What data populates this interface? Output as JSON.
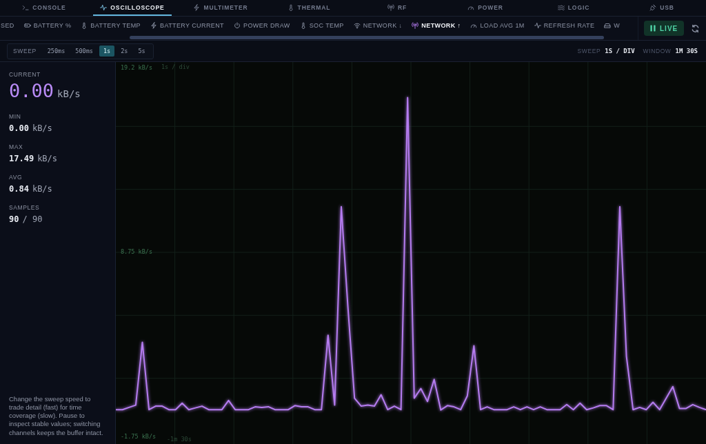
{
  "tabs": [
    {
      "label": "CONSOLE",
      "selected": false
    },
    {
      "label": "OSCILLOSCOPE",
      "selected": true
    },
    {
      "label": "MULTIMETER",
      "selected": false
    },
    {
      "label": "THERMAL",
      "selected": false
    },
    {
      "label": "RF",
      "selected": false
    },
    {
      "label": "POWER",
      "selected": false
    },
    {
      "label": "LOGIC",
      "selected": false
    },
    {
      "label": "USB",
      "selected": false
    }
  ],
  "channels": [
    {
      "label": "SED",
      "selected": false
    },
    {
      "label": "BATTERY %",
      "selected": false
    },
    {
      "label": "BATTERY TEMP",
      "selected": false
    },
    {
      "label": "BATTERY CURRENT",
      "selected": false
    },
    {
      "label": "POWER DRAW",
      "selected": false
    },
    {
      "label": "SOC TEMP",
      "selected": false
    },
    {
      "label": "NETWORK ↓",
      "selected": false
    },
    {
      "label": "NETWORK ↑",
      "selected": true
    },
    {
      "label": "LOAD AVG 1M",
      "selected": false
    },
    {
      "label": "REFRESH RATE",
      "selected": false
    },
    {
      "label": "W",
      "selected": false
    }
  ],
  "live_button": {
    "label": "LIVE",
    "active": true
  },
  "sweep": {
    "label": "SWEEP",
    "options": [
      {
        "label": "250ms",
        "selected": false
      },
      {
        "label": "500ms",
        "selected": false
      },
      {
        "label": "1s",
        "selected": true
      },
      {
        "label": "2s",
        "selected": false
      },
      {
        "label": "5s",
        "selected": false
      }
    ]
  },
  "readouts": [
    {
      "label": "SWEEP",
      "value": "1S / DIV"
    },
    {
      "label": "WINDOW",
      "value": "1M 30S"
    }
  ],
  "stats": [
    {
      "kind": "primary",
      "label": "CURRENT",
      "value": "0.00",
      "unit": "kB/s"
    },
    {
      "kind": "plain",
      "label": "MIN",
      "value": "0.00",
      "unit": "kB/s"
    },
    {
      "kind": "plain",
      "label": "MAX",
      "value": "17.49",
      "unit": "kB/s"
    },
    {
      "kind": "plain",
      "label": "AVG",
      "value": "0.84",
      "unit": "kB/s"
    },
    {
      "kind": "plain",
      "label": "SAMPLES",
      "value": "90",
      "unit": "/ 90"
    }
  ],
  "help_text": "Change the sweep speed to trade detail (fast) for time coverage (slow). Pause to inspect stable values; switching channels keeps the buffer intact.",
  "chart": {
    "chart_data": {
      "type": "line",
      "grid": true,
      "ylim": [
        -2.18,
        19.51
      ],
      "yticks": [
        {
          "value": 19.2,
          "label": "19.2 kB/s"
        },
        {
          "value": 8.75,
          "label": "8.75 kB/s"
        },
        {
          "value": -1.75,
          "label": "-1.75 kB/s"
        }
      ],
      "annotations": [
        {
          "text": "1s / div"
        },
        {
          "text": "-1m 30s"
        }
      ],
      "series": [
        {
          "color": "#b57cf0",
          "values": [
            -0.23,
            -0.23,
            -0.1,
            0.03,
            3.6,
            -0.23,
            -0.03,
            -0.03,
            -0.23,
            -0.23,
            0.14,
            -0.23,
            -0.13,
            -0.03,
            -0.23,
            -0.23,
            -0.23,
            0.29,
            -0.23,
            -0.23,
            -0.23,
            -0.07,
            -0.1,
            -0.06,
            -0.23,
            -0.23,
            -0.23,
            0.0,
            -0.07,
            -0.07,
            -0.23,
            -0.23,
            4.0,
            0.03,
            11.3,
            5.6,
            0.42,
            -0.03,
            0.03,
            -0.03,
            0.62,
            -0.23,
            -0.03,
            -0.23,
            17.49,
            0.42,
            0.97,
            0.23,
            1.49,
            -0.25,
            0.0,
            -0.07,
            -0.23,
            0.55,
            3.4,
            -0.23,
            -0.07,
            -0.23,
            -0.23,
            -0.23,
            -0.07,
            -0.23,
            -0.07,
            -0.23,
            -0.07,
            -0.23,
            -0.23,
            -0.23,
            0.06,
            -0.23,
            0.14,
            -0.23,
            -0.13,
            0.0,
            0.0,
            -0.23,
            11.3,
            2.8,
            -0.23,
            -0.1,
            -0.23,
            0.19,
            -0.23,
            0.42,
            1.08,
            -0.16,
            -0.16,
            0.06,
            -0.1,
            -0.23
          ]
        }
      ]
    }
  }
}
